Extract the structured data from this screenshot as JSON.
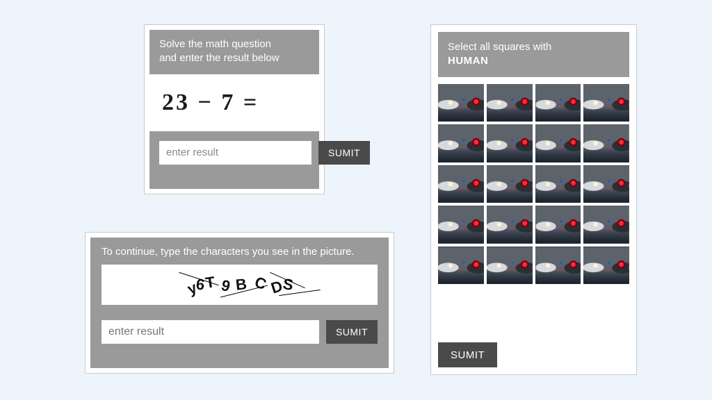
{
  "math_captcha": {
    "prompt_line1": "Solve the math question",
    "prompt_line2": "and enter the result below",
    "equation": "23 − 7 =",
    "input_placeholder": "enter result",
    "submit_label": "SUMIT"
  },
  "text_captcha": {
    "prompt": "To continue, type the characters you see in the picture.",
    "chars": [
      "y",
      "6",
      "T",
      "9",
      "B",
      "C",
      "D",
      "S"
    ],
    "input_placeholder": "enter result",
    "submit_label": "SUMIT"
  },
  "image_captcha": {
    "prompt_prefix": "Select all squares with",
    "target": "HUMAN",
    "grid_cols": 4,
    "grid_rows": 5,
    "submit_label": "SUMIT"
  }
}
